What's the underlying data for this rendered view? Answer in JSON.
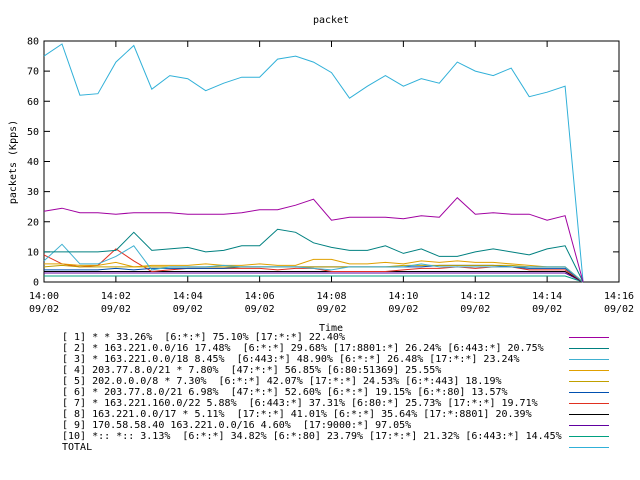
{
  "chart_data": {
    "type": "line",
    "title": "packet",
    "xlabel": "Time",
    "ylabel": "packets (Kpps)",
    "ylim": [
      0,
      80
    ],
    "yticks": [
      0,
      10,
      20,
      30,
      40,
      50,
      60,
      70,
      80
    ],
    "xlim_minutes": [
      0,
      16
    ],
    "xticks": [
      {
        "time": "14:00",
        "date": "09/02"
      },
      {
        "time": "14:02",
        "date": "09/02"
      },
      {
        "time": "14:04",
        "date": "09/02"
      },
      {
        "time": "14:06",
        "date": "09/02"
      },
      {
        "time": "14:08",
        "date": "09/02"
      },
      {
        "time": "14:10",
        "date": "09/02"
      },
      {
        "time": "14:12",
        "date": "09/02"
      },
      {
        "time": "14:14",
        "date": "09/02"
      },
      {
        "time": "14:16",
        "date": "09/02"
      }
    ],
    "x": [
      "14:00",
      "14:00:30",
      "14:01",
      "14:01:30",
      "14:02",
      "14:02:30",
      "14:03",
      "14:03:30",
      "14:04",
      "14:04:30",
      "14:05",
      "14:05:30",
      "14:06",
      "14:06:30",
      "14:07",
      "14:07:30",
      "14:08",
      "14:08:30",
      "14:09",
      "14:09:30",
      "14:10",
      "14:10:30",
      "14:11",
      "14:11:30",
      "14:12",
      "14:12:30",
      "14:13",
      "14:13:30",
      "14:14",
      "14:14:30",
      "14:15"
    ],
    "grid": false,
    "legend_position": "bottom",
    "series": [
      {
        "name": "[ 1] * * 33.26%  [6:*:*] 75.10% [17:*:*] 22.40%",
        "color": "#a000a0",
        "values": [
          23.5,
          24.5,
          23,
          23,
          22.5,
          23,
          23,
          23,
          22.5,
          22.5,
          22.5,
          23,
          24,
          24,
          25.5,
          27.5,
          20.5,
          21.5,
          21.5,
          21.5,
          21,
          22,
          21.5,
          28,
          22.5,
          23,
          22.5,
          22.5,
          20.5,
          22,
          0
        ]
      },
      {
        "name": "[ 2] * 163.221.0.0/16 17.48%  [6:*:*] 29.68% [17:8801:*] 26.24% [6:443:*] 20.75%",
        "color": "#008080",
        "values": [
          10,
          10,
          10,
          10,
          10.5,
          16.5,
          10.5,
          11,
          11.5,
          10,
          10.5,
          12,
          12,
          17.5,
          16.5,
          13,
          11.5,
          10.5,
          10.5,
          12,
          9.5,
          11,
          8.5,
          8.5,
          10,
          11,
          10,
          9,
          11,
          12,
          0
        ]
      },
      {
        "name": "[ 3] * 163.221.0.0/18 8.45%  [6:443:*] 48.90% [6:*:*] 26.48% [17:*:*] 23.24%",
        "color": "#40b0d0",
        "values": [
          7,
          12.5,
          6,
          6,
          8.5,
          12,
          4,
          5,
          5,
          5,
          5.5,
          5,
          5,
          5,
          5,
          4.5,
          4,
          5,
          5,
          5,
          5,
          6,
          5,
          5,
          5,
          5,
          5,
          5,
          5,
          5,
          0
        ]
      },
      {
        "name": "[ 4] 203.77.8.0/21 * 7.80%  [47:*:*] 56.85% [6:80:51369] 25.55%",
        "color": "#e0a000",
        "values": [
          6,
          6,
          5.5,
          5.5,
          6.5,
          5,
          5.5,
          5.5,
          5.5,
          6,
          5.5,
          5.5,
          6,
          5.5,
          5.5,
          7.5,
          7.5,
          6,
          6,
          6.5,
          6,
          7,
          6.5,
          7,
          6.5,
          6.5,
          6,
          5.5,
          5,
          5,
          0
        ]
      },
      {
        "name": "[ 5] 202.0.0.0/8 * 7.30%  [6:*:*] 42.07% [17:*:*] 24.53% [6:*:443] 18.19%",
        "color": "#c0a000",
        "values": [
          5,
          5.5,
          5,
          5,
          5,
          5,
          5,
          5,
          5,
          5,
          5,
          5,
          5,
          5,
          5,
          5,
          5,
          5,
          5,
          5,
          5.5,
          5.5,
          5.5,
          5.5,
          5.5,
          5.5,
          5.5,
          5,
          5,
          5,
          0
        ]
      },
      {
        "name": "[ 6] * 203.77.8.0/21 6.98%  [47:*:*] 52.60% [6:*:*] 19.15% [6:*:80] 13.57%",
        "color": "#0050b0",
        "values": [
          4,
          4,
          4,
          4,
          4.5,
          4,
          4.5,
          4.5,
          4.5,
          4.5,
          4.5,
          5,
          5,
          5,
          5,
          5,
          5,
          5,
          5,
          5,
          5,
          5,
          5.5,
          5.5,
          5.5,
          5.5,
          5,
          4.5,
          4.5,
          4.5,
          0
        ]
      },
      {
        "name": "[ 7] * 163.221.160.0/22 5.88%  [6:443:*] 37.31% [6:80:*] 25.73% [17:*:*] 19.71%",
        "color": "#e03020",
        "values": [
          9,
          6,
          5,
          5.5,
          11,
          7,
          3.5,
          4,
          4.5,
          4.5,
          4.5,
          4.5,
          4.5,
          4,
          4.5,
          4.5,
          3.5,
          3.5,
          3.5,
          3.5,
          4,
          4.5,
          4.5,
          5,
          4.5,
          5,
          5,
          4,
          4,
          4,
          0
        ]
      },
      {
        "name": "[ 8] 163.221.0.0/17 * 5.11%  [17:*:*] 41.01% [6:*:*] 35.64% [17:*:8801] 20.39%",
        "color": "#000000",
        "values": [
          3.5,
          3.5,
          3.5,
          3.5,
          3.5,
          3.5,
          3.5,
          3.5,
          3.5,
          3.5,
          3.5,
          3.5,
          3.5,
          3.5,
          3.5,
          3.5,
          3.5,
          3.5,
          3.5,
          3.5,
          3.5,
          3.5,
          3.5,
          3.5,
          3.5,
          3.5,
          3.5,
          3.5,
          3.5,
          3.5,
          0
        ]
      },
      {
        "name": "[ 9] 170.58.58.40 163.221.0.0/16 4.60%  [17:9000:*] 97.05%",
        "color": "#6000a0",
        "values": [
          3,
          3,
          3,
          3,
          3,
          3,
          3,
          3,
          3,
          3,
          3,
          3,
          3,
          3,
          3,
          3,
          3,
          3,
          3,
          3,
          3,
          3,
          3,
          3,
          3,
          3,
          3,
          3,
          3,
          3,
          0
        ]
      },
      {
        "name": "[10] *:: *:: 3.13%  [6:*:*] 34.82% [6:*:80] 23.79% [17:*:*] 21.32% [6:443:*] 14.45%",
        "color": "#00a080",
        "values": [
          2,
          2,
          2,
          2,
          2,
          2,
          2,
          2,
          2,
          2,
          2,
          2,
          2,
          2,
          2,
          2,
          2,
          2,
          2,
          2,
          2,
          2,
          2,
          2,
          2,
          2,
          2,
          2,
          2,
          2,
          0
        ]
      },
      {
        "name": "TOTAL",
        "color": "#30b0d8",
        "values": [
          75,
          79,
          62,
          62.5,
          73,
          78.5,
          64,
          68.5,
          67.5,
          63.5,
          66,
          68,
          68,
          74,
          75,
          73,
          69.5,
          61,
          65,
          68.5,
          65,
          67.5,
          66,
          73,
          70,
          68.5,
          71,
          61.5,
          63,
          65,
          0
        ]
      }
    ]
  }
}
